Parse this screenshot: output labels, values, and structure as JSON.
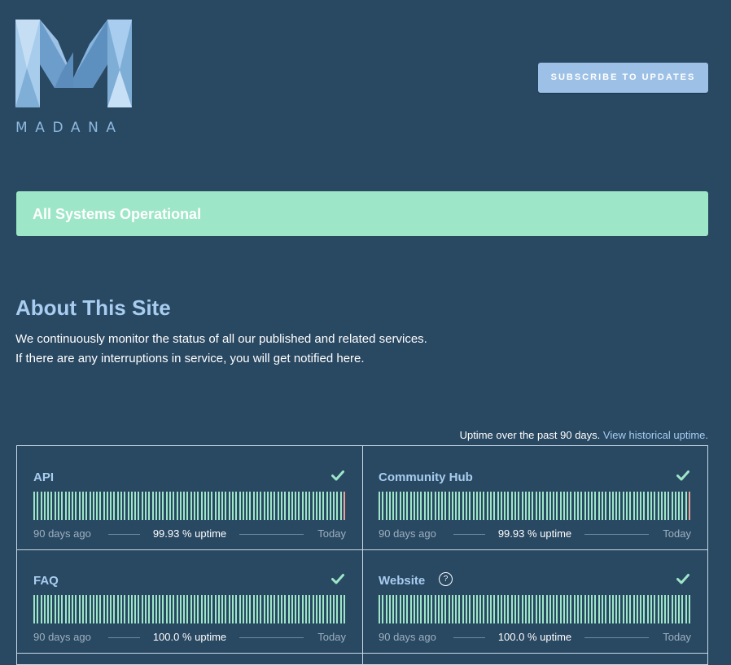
{
  "header": {
    "logo_text": "MADANA",
    "subscribe_label": "SUBSCRIBE TO UPDATES"
  },
  "status": {
    "text": "All Systems Operational",
    "color": "#9ee6c8"
  },
  "about": {
    "title": "About This Site",
    "line1": "We continuously monitor the status of all our published and related services.",
    "line2": "If there are any interruptions in service, you will get notified here."
  },
  "uptime": {
    "note": "Uptime over the past 90 days.",
    "link": "View historical uptime."
  },
  "components": [
    {
      "name": "API",
      "uptime": "99.93 % uptime",
      "left_label": "90 days ago",
      "right_label": "Today",
      "status_icon": "check-icon",
      "incident_days": [
        90
      ]
    },
    {
      "name": "Community Hub",
      "uptime": "99.93 % uptime",
      "left_label": "90 days ago",
      "right_label": "Today",
      "status_icon": "check-icon",
      "incident_days": [
        90
      ]
    },
    {
      "name": "FAQ",
      "uptime": "100.0 % uptime",
      "left_label": "90 days ago",
      "right_label": "Today",
      "status_icon": "check-icon",
      "incident_days": []
    },
    {
      "name": "Website",
      "uptime": "100.0 % uptime",
      "left_label": "90 days ago",
      "right_label": "Today",
      "status_icon": "check-icon",
      "info_icon": "?",
      "incident_days": []
    }
  ],
  "colors": {
    "background": "#294862",
    "operational": "#9ee6c8",
    "minor_outage": "#e8a19a",
    "accent": "#a9cdf0",
    "button": "#9dc1e6"
  }
}
